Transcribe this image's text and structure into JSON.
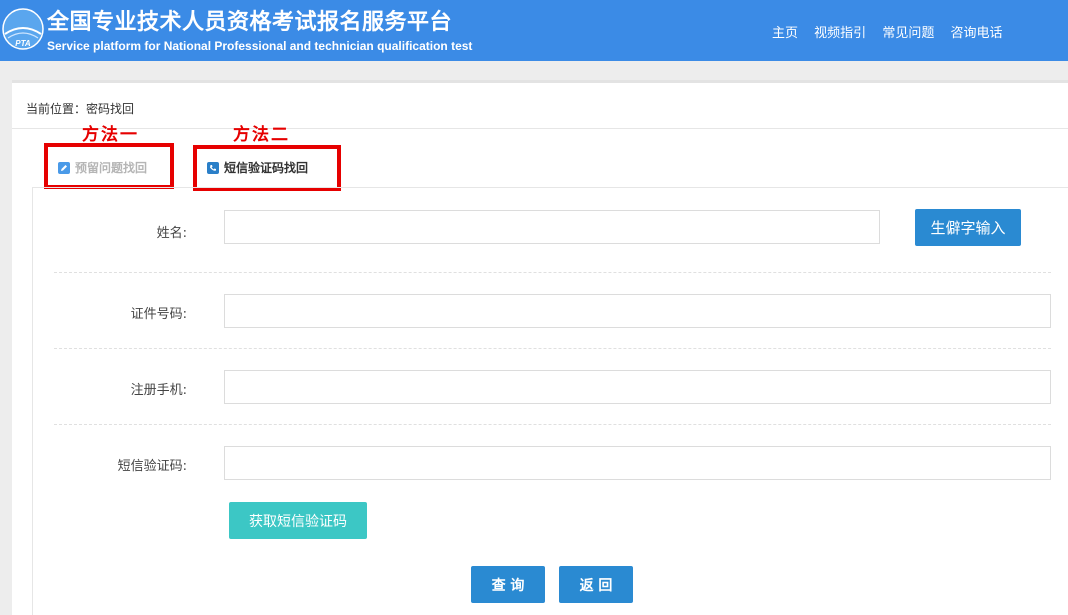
{
  "header": {
    "logo_text": "PTA",
    "title_cn": "全国专业技术人员资格考试报名服务平台",
    "title_en": "Service platform for National Professional and technician qualification test",
    "nav": [
      "主页",
      "视频指引",
      "常见问题",
      "咨询电话"
    ]
  },
  "breadcrumb": "当前位置：密码找回",
  "annotations": {
    "method1": "方法一",
    "method2": "方法二"
  },
  "tabs": [
    {
      "label": "预留问题找回",
      "icon": "edit-icon"
    },
    {
      "label": "短信验证码找回",
      "icon": "phone-icon"
    }
  ],
  "form": {
    "name_label": "姓名:",
    "name_value": "",
    "rare_char_button": "生僻字输入",
    "id_label": "证件号码:",
    "id_value": "",
    "phone_label": "注册手机:",
    "phone_value": "",
    "sms_label": "短信验证码:",
    "sms_value": "",
    "get_sms_button": "获取短信验证码",
    "query_button": "查 询",
    "back_button": "返 回"
  },
  "colors": {
    "header_bg": "#3b8be6",
    "annotation_red": "#e60000",
    "button_blue": "#2a8ad2",
    "button_teal": "#3cc7c5"
  }
}
